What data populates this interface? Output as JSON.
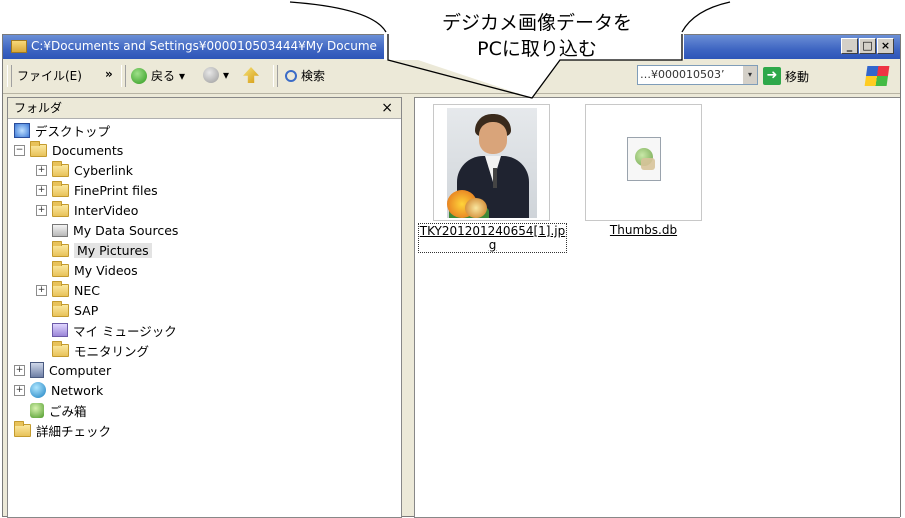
{
  "window": {
    "title": "C:¥Documents and Settings¥000010503444¥My Docume"
  },
  "title_buttons": {
    "minimize": "_",
    "maximize": "□",
    "close": "×"
  },
  "toolbar": {
    "file_menu": "ファイル(E)",
    "chevron": "»",
    "back": "戻る",
    "back_dropdown": "▾",
    "forward_dropdown": "▾",
    "search": "検索",
    "address_value": "…¥000010503’",
    "address_dropdown": "▾",
    "go": "移動"
  },
  "folder_pane": {
    "header": "フォルダ",
    "close": "×",
    "tree": [
      {
        "label": "デスクトップ"
      },
      {
        "label": "Documents"
      },
      {
        "label": "Cyberlink"
      },
      {
        "label": "FinePrint files"
      },
      {
        "label": "InterVideo"
      },
      {
        "label": "My Data Sources"
      },
      {
        "label": "My Pictures"
      },
      {
        "label": "My Videos"
      },
      {
        "label": "NEC"
      },
      {
        "label": "SAP"
      },
      {
        "label": "マイ ミュージック"
      },
      {
        "label": "モニタリング"
      },
      {
        "label": "Computer"
      },
      {
        "label": "Network"
      },
      {
        "label": "ごみ箱"
      },
      {
        "label": "詳細チェック"
      }
    ],
    "expanders": {
      "plus": "+",
      "minus": "−"
    }
  },
  "files": [
    {
      "name_line1": "TKY201201240654[1].jp",
      "name_line2": "g"
    },
    {
      "name_line1": "Thumbs.db"
    }
  ],
  "callout": {
    "line1": "デジカメ画像データを",
    "line2": "PCに取り込む"
  }
}
